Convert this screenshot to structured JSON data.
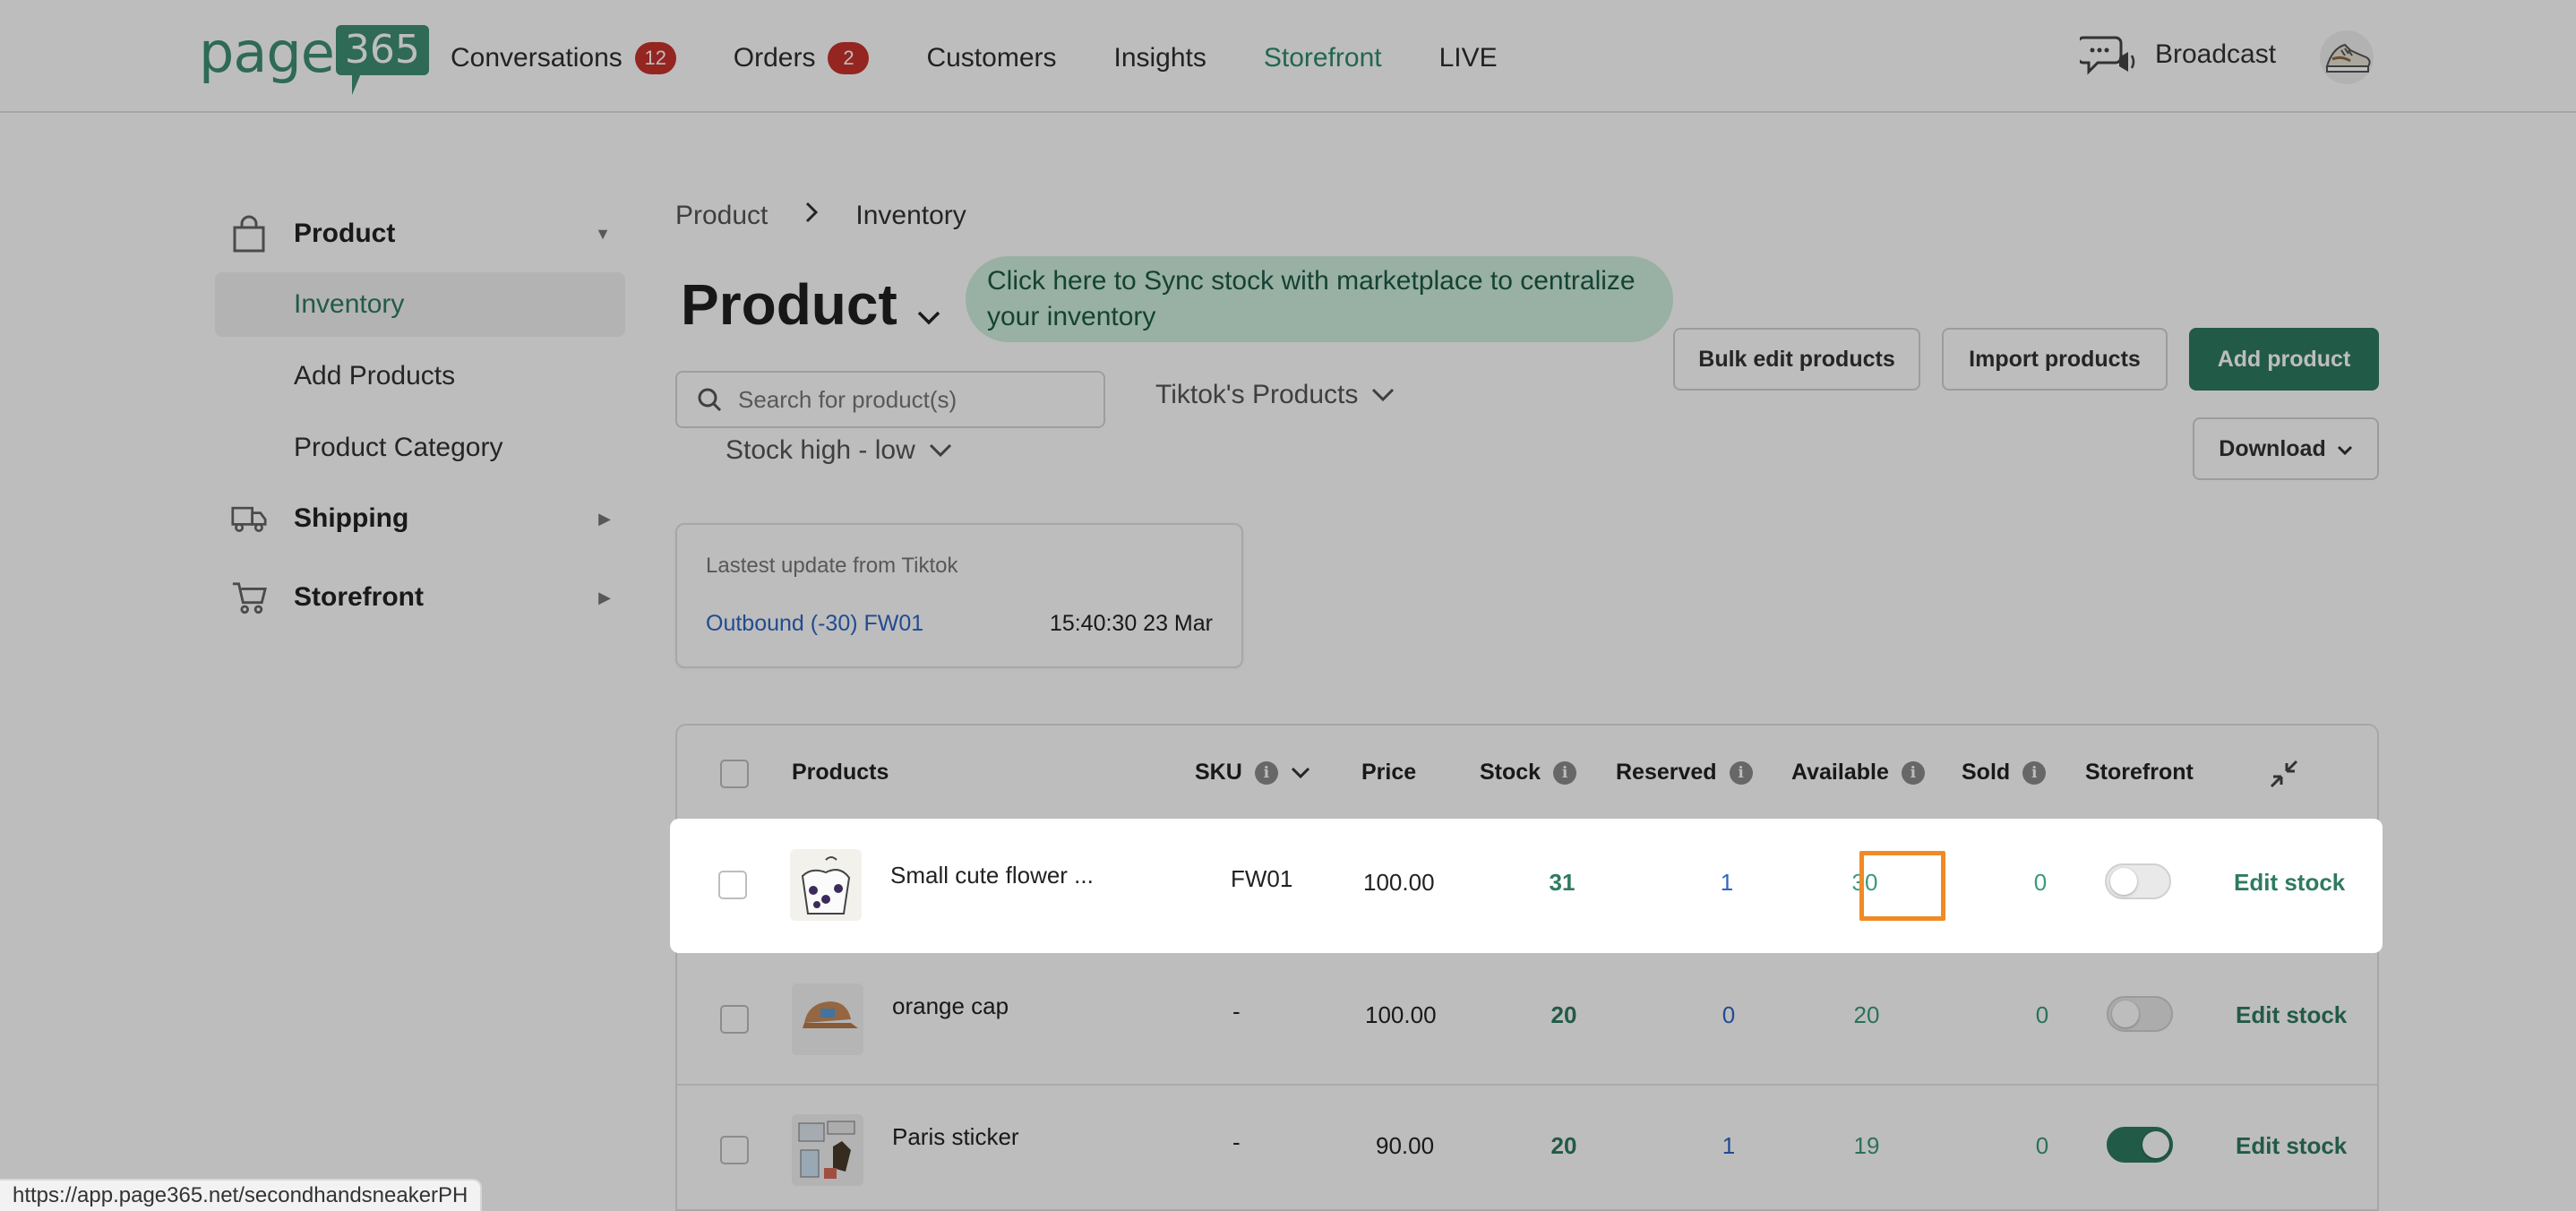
{
  "brand": {
    "logo_text": "page",
    "logo_num": "365"
  },
  "nav": {
    "items": [
      {
        "label": "Conversations",
        "badge": "12"
      },
      {
        "label": "Orders",
        "badge": "2"
      },
      {
        "label": "Customers"
      },
      {
        "label": "Insights"
      },
      {
        "label": "Storefront"
      },
      {
        "label": "LIVE"
      }
    ],
    "broadcast": "Broadcast",
    "active_color": "#2f8a6c",
    "badge_color": "#c8322d"
  },
  "sidebar": {
    "product": "Product",
    "sub": [
      "Inventory",
      "Add Products",
      "Product Category"
    ],
    "shipping": "Shipping",
    "storefront": "Storefront"
  },
  "breadcrumb": {
    "root": "Product",
    "current": "Inventory"
  },
  "page": {
    "title": "Product",
    "sync_tip": "Click here to Sync stock with marketplace to centralize your inventory",
    "bulk_edit": "Bulk edit products",
    "import": "Import products",
    "add": "Add product",
    "download": "Download",
    "accent": "#2f7a62"
  },
  "filters": {
    "search_placeholder": "Search for product(s)",
    "source": "Tiktok's Products",
    "sort": "Stock high - low"
  },
  "update_card": {
    "title": "Lastest update from Tiktok",
    "event": "Outbound (-30) FW01",
    "time": "15:40:30 23 Mar"
  },
  "table": {
    "headers": {
      "products": "Products",
      "sku": "SKU",
      "price": "Price",
      "stock": "Stock",
      "reserved": "Reserved",
      "available": "Available",
      "sold": "Sold",
      "storefront": "Storefront"
    },
    "rows": [
      {
        "name": "Small cute flower ...",
        "sku": "FW01",
        "price": "100.00",
        "stock": "31",
        "reserved": "1",
        "available": "30",
        "sold": "0",
        "storefront_on": false,
        "action": "Edit stock"
      },
      {
        "name": "orange cap",
        "sku": "-",
        "price": "100.00",
        "stock": "20",
        "reserved": "0",
        "available": "20",
        "sold": "0",
        "storefront_on": false,
        "action": "Edit stock"
      },
      {
        "name": "Paris sticker",
        "sku": "-",
        "price": "90.00",
        "stock": "20",
        "reserved": "1",
        "available": "19",
        "sold": "0",
        "storefront_on": true,
        "action": "Edit stock"
      }
    ]
  },
  "status_url": "https://app.page365.net/secondhandsneakerPH",
  "highlight_color": "#f08a24"
}
